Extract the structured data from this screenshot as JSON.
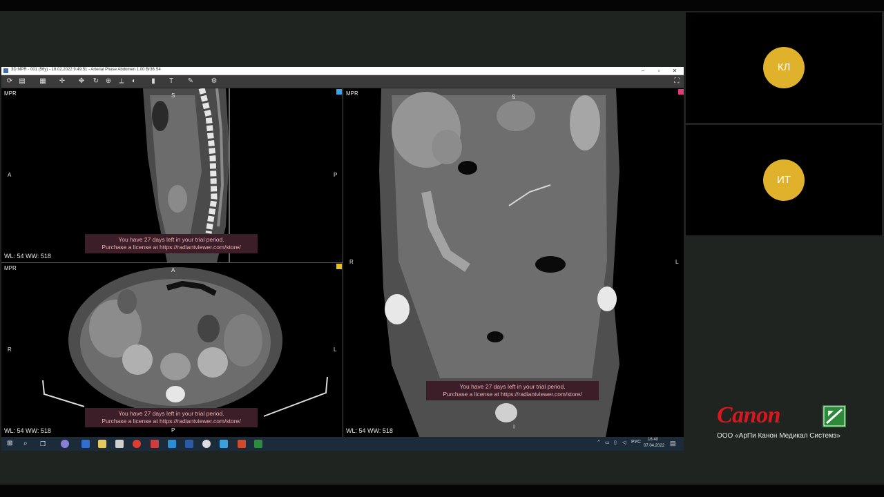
{
  "window": {
    "title": "3D MPR - 001 (56y) - 18.02.2022 9:49:51 - Arterial Phase Abdomen 1.00 Br36 S4",
    "controls": {
      "minimize": "–",
      "maximize": "▫",
      "close": "✕"
    }
  },
  "viewports": {
    "sagittal": {
      "label": "MPR",
      "orient_left": "A",
      "orient_right": "P",
      "orient_top": "S",
      "wl": "WL: 54 WW: 518",
      "marker_color": "#3aa6e8"
    },
    "axial": {
      "label": "MPR",
      "orient_left": "R",
      "orient_right": "L",
      "orient_top": "A",
      "orient_bottom": "P",
      "wl": "WL: 54 WW: 518",
      "marker_color": "#e8c21b"
    },
    "coronal": {
      "label": "MPR",
      "orient_left": "R",
      "orient_right": "L",
      "orient_top": "S",
      "orient_bottom": "I",
      "wl": "WL: 54 WW: 518",
      "marker_color": "#e33b7a"
    }
  },
  "trial": {
    "line1": "You have 27 days left in your trial period.",
    "line2": "Purchase a license at https://radiantviewer.com/store/"
  },
  "taskbar": {
    "lang": "РУС",
    "time": "16:40",
    "date": "07.04.2022"
  },
  "participants": [
    {
      "initials": "КЛ",
      "color": "#e0b12b"
    },
    {
      "initials": "ИТ",
      "color": "#e0b12b"
    }
  ],
  "branding": {
    "logo_text": "Canon",
    "company": "ООО «АрПи Канон Медикал Системз»",
    "brand_color": "#d9171e"
  }
}
